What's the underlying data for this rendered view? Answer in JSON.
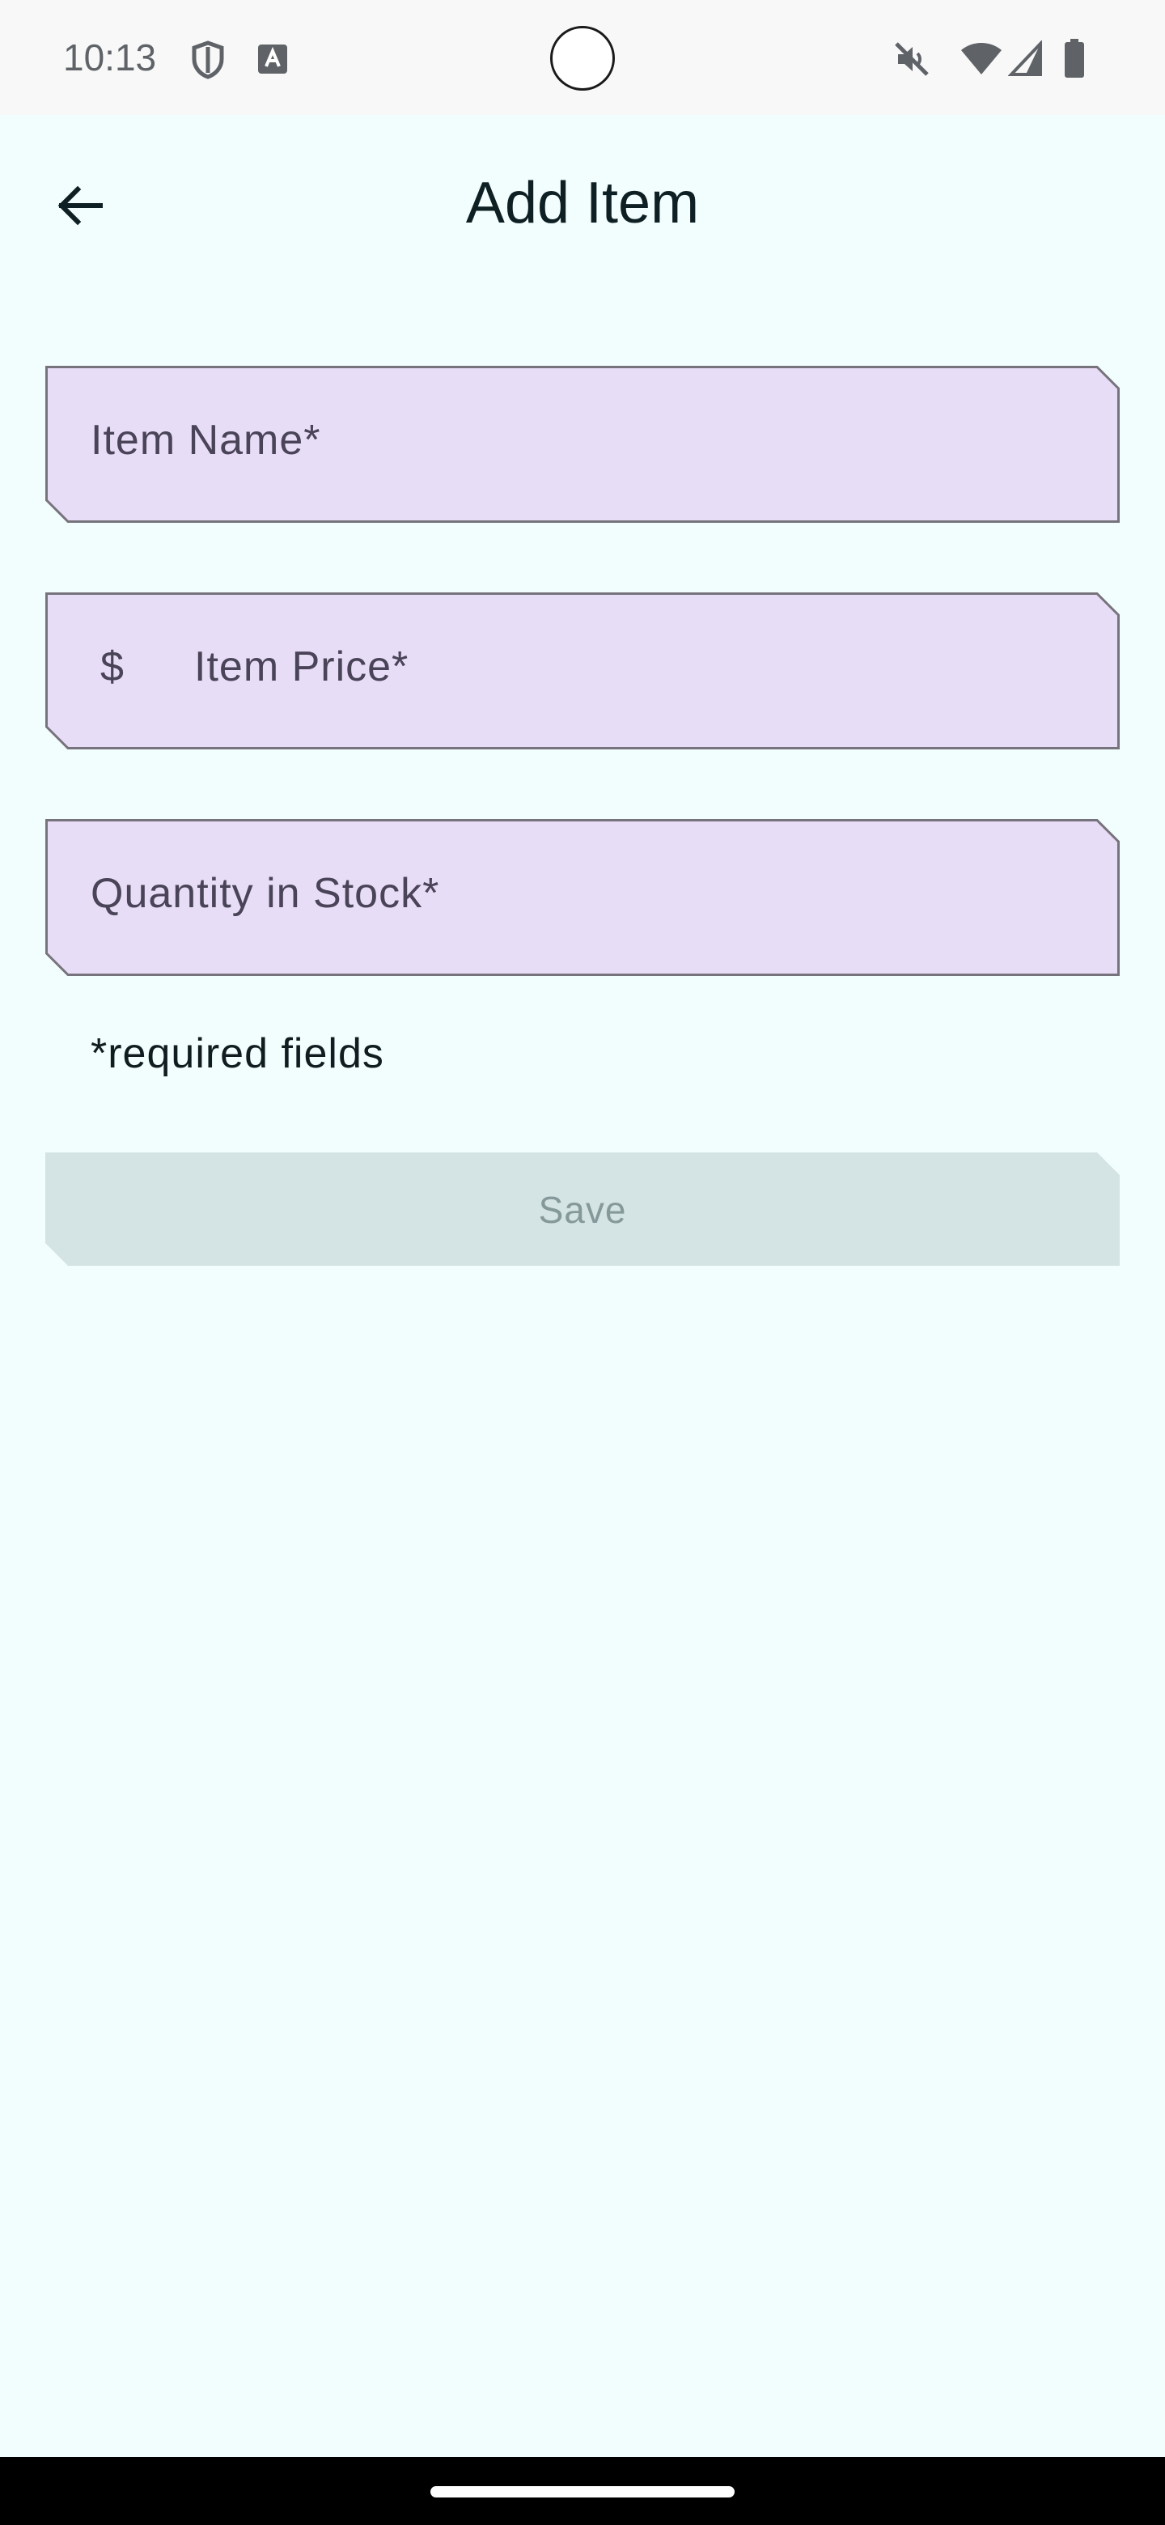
{
  "status_bar": {
    "time": "10:13",
    "icons_left": [
      "shield-icon",
      "font-icon"
    ],
    "icons_right": [
      "mute-icon",
      "wifi-icon",
      "signal-icon",
      "battery-icon"
    ]
  },
  "header": {
    "title": "Add Item",
    "back_icon": "arrow-back-icon"
  },
  "form": {
    "item_name": {
      "label": "Item Name*",
      "value": ""
    },
    "item_price": {
      "prefix": "$",
      "label": "Item Price*",
      "value": ""
    },
    "quantity": {
      "label": "Quantity in Stock*",
      "value": ""
    },
    "required_note": "*required fields"
  },
  "actions": {
    "save_label": "Save",
    "save_enabled": false
  },
  "colors": {
    "background": "#f2fefd",
    "field_fill": "#e8ddf6",
    "field_border": "#77737c",
    "button_disabled_fill": "#d4e3e3",
    "button_disabled_text": "#86999a",
    "title_text": "#0f2024"
  }
}
